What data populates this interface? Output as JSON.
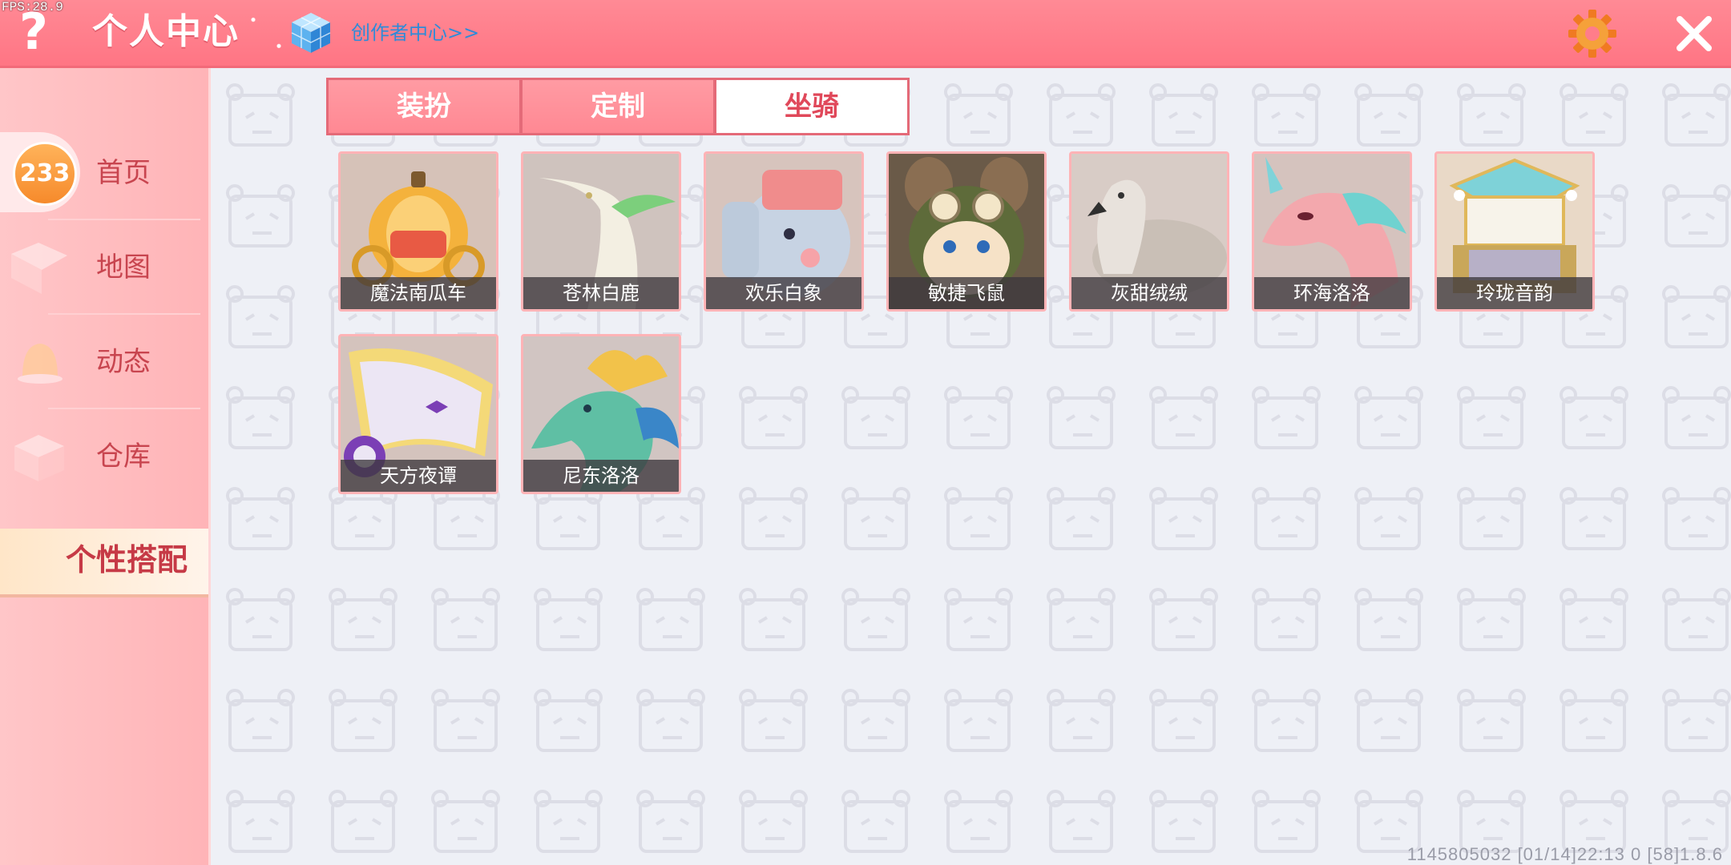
{
  "fps": "FPS:28.9",
  "header": {
    "help_icon": "question-mark",
    "title": "个人中心",
    "creator_link": "创作者中心>>",
    "settings_icon": "gear-icon",
    "close_icon": "close-icon"
  },
  "sidebar": {
    "badge": "233",
    "items": [
      {
        "label": "首页",
        "icon": "home-icon"
      },
      {
        "label": "地图",
        "icon": "map-icon"
      },
      {
        "label": "动态",
        "icon": "bell-icon"
      },
      {
        "label": "仓库",
        "icon": "storage-icon"
      },
      {
        "label": "个性搭配",
        "icon": "outfit-icon",
        "active": true
      }
    ]
  },
  "tabs": [
    {
      "label": "装扮",
      "selected": false
    },
    {
      "label": "定制",
      "selected": false
    },
    {
      "label": "坐骑",
      "selected": true
    }
  ],
  "mounts": [
    {
      "name": "魔法南瓜车",
      "icon": "pumpkin-carriage"
    },
    {
      "name": "苍林白鹿",
      "icon": "white-deer"
    },
    {
      "name": "欢乐白象",
      "icon": "elephant"
    },
    {
      "name": "敏捷飞鼠",
      "icon": "flying-squirrel"
    },
    {
      "name": "灰甜绒绒",
      "icon": "swan"
    },
    {
      "name": "环海洛洛",
      "icon": "unicorn-serpent"
    },
    {
      "name": "玲珑音韵",
      "icon": "pavilion"
    },
    {
      "name": "天方夜谭",
      "icon": "flying-carpet"
    },
    {
      "name": "尼东洛洛",
      "icon": "sea-dragon"
    }
  ],
  "footer": "1145805032    [01/14]22:13 0   [58]1.8.6",
  "colors": {
    "header": "#ff7d8a",
    "sidebar": "#ffbcbe",
    "accent": "#e0485a",
    "background": "#eef0f6"
  }
}
